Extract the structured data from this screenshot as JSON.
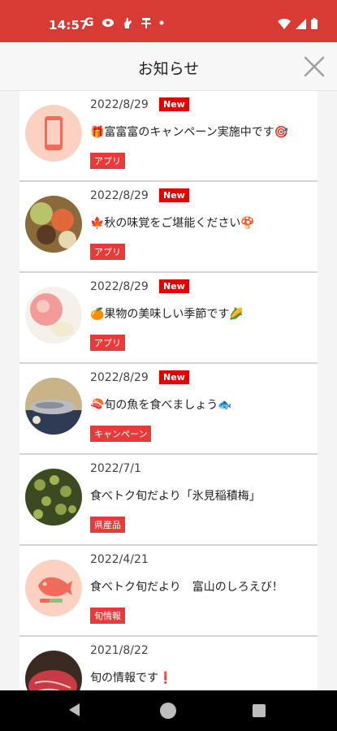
{
  "status_bar": {
    "time": "14:57",
    "letter": "G",
    "colors": {
      "bar": "#d83a34"
    }
  },
  "header": {
    "title": "お知らせ"
  },
  "notices": [
    {
      "date": "2022/8/29",
      "badge": "New",
      "title": "🎁富富富のキャンペーン実施中です🎯",
      "tag": "アプリ",
      "image": "phone-icon"
    },
    {
      "date": "2022/8/29",
      "badge": "New",
      "title": "🍁秋の味覚をご堪能ください🍄",
      "tag": "アプリ",
      "image": "autumn-food-photo"
    },
    {
      "date": "2022/8/29",
      "badge": "New",
      "title": "🍊果物の美味しい季節です🌽",
      "tag": "アプリ",
      "image": "peach-photo"
    },
    {
      "date": "2022/8/29",
      "badge": "New",
      "title": "🍣旬の魚を食べましょう🐟",
      "tag": "キャンペーン",
      "image": "grilled-fish-photo"
    },
    {
      "date": "2022/7/1",
      "badge": "",
      "title": "食べトク旬だより「氷見稲積梅」",
      "tag": "県産品",
      "image": "plums-photo"
    },
    {
      "date": "2022/4/21",
      "badge": "",
      "title": "食べトク旬だより　富山のしろえび！",
      "tag": "旬情報",
      "image": "food-icon"
    },
    {
      "date": "2021/8/22",
      "badge": "",
      "title": "旬の情報です❗",
      "tag": "",
      "image": "beef-photo"
    }
  ],
  "colors": {
    "accent": "#d83a34",
    "badge_new": "#e00000",
    "tag": "#e83a3a"
  }
}
